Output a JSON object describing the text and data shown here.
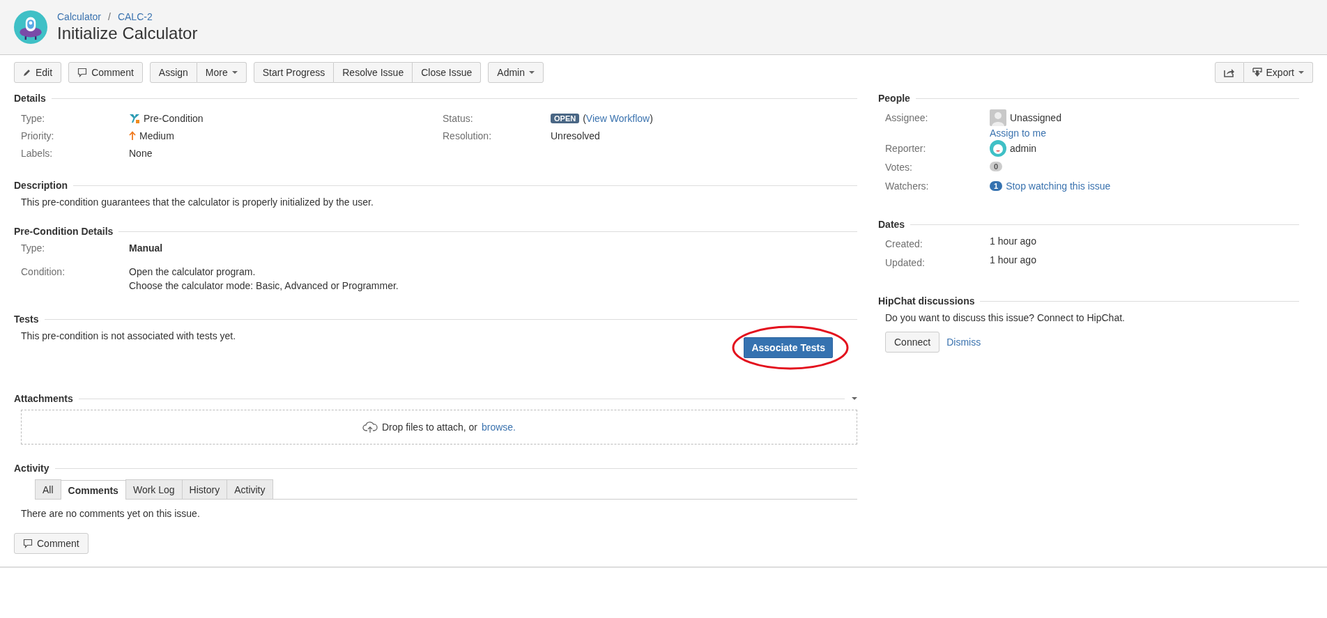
{
  "header": {
    "breadcrumbs": [
      "Calculator",
      "CALC-2"
    ],
    "breadcrumb_separator": "/",
    "title": "Initialize Calculator"
  },
  "toolbar": {
    "groups": [
      {
        "buttons": [
          {
            "label": "Edit",
            "kind": "edit",
            "dropdown": false
          }
        ]
      },
      {
        "buttons": [
          {
            "label": "Comment",
            "kind": "comment",
            "dropdown": false
          }
        ]
      },
      {
        "buttons": [
          {
            "label": "Assign",
            "kind": "plain",
            "dropdown": false
          },
          {
            "label": "More",
            "kind": "plain",
            "dropdown": true
          }
        ]
      },
      {
        "buttons": [
          {
            "label": "Start Progress",
            "kind": "plain",
            "dropdown": false
          },
          {
            "label": "Resolve Issue",
            "kind": "plain",
            "dropdown": false
          },
          {
            "label": "Close Issue",
            "kind": "plain",
            "dropdown": false
          }
        ]
      },
      {
        "buttons": [
          {
            "label": "Admin",
            "kind": "plain",
            "dropdown": true
          }
        ]
      }
    ],
    "right_buttons": [
      {
        "kind": "share",
        "dropdown": false
      },
      {
        "label": "Export",
        "kind": "export",
        "dropdown": true
      }
    ]
  },
  "details": {
    "title": "Details",
    "left": [
      {
        "label": "Type:",
        "value": "Pre-Condition",
        "kind": "type"
      },
      {
        "label": "Priority:",
        "value": "Medium",
        "kind": "priority"
      },
      {
        "label": "Labels:",
        "value": "None",
        "kind": "text"
      }
    ],
    "right": [
      {
        "label": "Status:",
        "value": "OPEN",
        "link_open": "(",
        "link": "View Workflow",
        "link_close": ")",
        "kind": "status"
      },
      {
        "label": "Resolution:",
        "value": "Unresolved",
        "kind": "text"
      }
    ]
  },
  "description": {
    "title": "Description",
    "text": "This pre-condition guarantees that the calculator is properly initialized by the user."
  },
  "precondition_details": {
    "title": "Pre-Condition Details",
    "type_label": "Type:",
    "type_value": "Manual",
    "condition_label": "Condition:",
    "condition_lines": [
      "Open the calculator program.",
      "Choose the calculator mode: Basic, Advanced or Programmer."
    ]
  },
  "tests": {
    "title": "Tests",
    "text": "This pre-condition is not associated with tests yet.",
    "button": "Associate Tests",
    "highlighted": true
  },
  "attachments": {
    "title": "Attachments",
    "drop_text": "Drop files to attach, or",
    "browse_link": "browse."
  },
  "activity": {
    "title": "Activity",
    "tabs": [
      {
        "label": "All",
        "selected": false
      },
      {
        "label": "Comments",
        "selected": true
      },
      {
        "label": "Work Log",
        "selected": false
      },
      {
        "label": "History",
        "selected": false
      },
      {
        "label": "Activity",
        "selected": false
      }
    ],
    "empty_text": "There are no comments yet on this issue.",
    "comment_button": "Comment"
  },
  "people": {
    "title": "People",
    "assignee_label": "Assignee:",
    "assignee": "Unassigned",
    "assign_link": "Assign to me",
    "reporter_label": "Reporter:",
    "reporter": "admin",
    "votes_label": "Votes:",
    "votes": "0",
    "watchers_label": "Watchers:",
    "watchers": "1",
    "watch_link": "Stop watching this issue"
  },
  "dates": {
    "title": "Dates",
    "rows": [
      {
        "label": "Created:",
        "value": "1 hour ago"
      },
      {
        "label": "Updated:",
        "value": "1 hour ago"
      }
    ]
  },
  "hipchat": {
    "title": "HipChat discussions",
    "text": "Do you want to discuss this issue? Connect to HipChat.",
    "connect": "Connect",
    "dismiss": "Dismiss"
  }
}
